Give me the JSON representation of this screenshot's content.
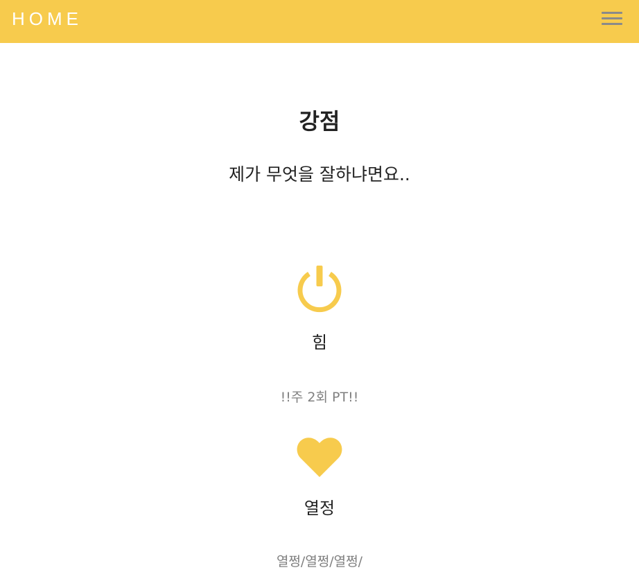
{
  "navbar": {
    "brand": "HOME",
    "menu_icon": "hamburger-menu-icon",
    "background_color": "#f7cb4d"
  },
  "strengths": {
    "title": "강점",
    "subtitle": "제가 무엇을 잘하냐면요..",
    "accent_color": "#f7cb4d",
    "items": [
      {
        "icon": "power-icon",
        "title": "힘",
        "text": "!!주 2회 PT!!"
      },
      {
        "icon": "heart-icon",
        "title": "열정",
        "text": "열쩡/열쩡/열쩡/"
      }
    ]
  }
}
